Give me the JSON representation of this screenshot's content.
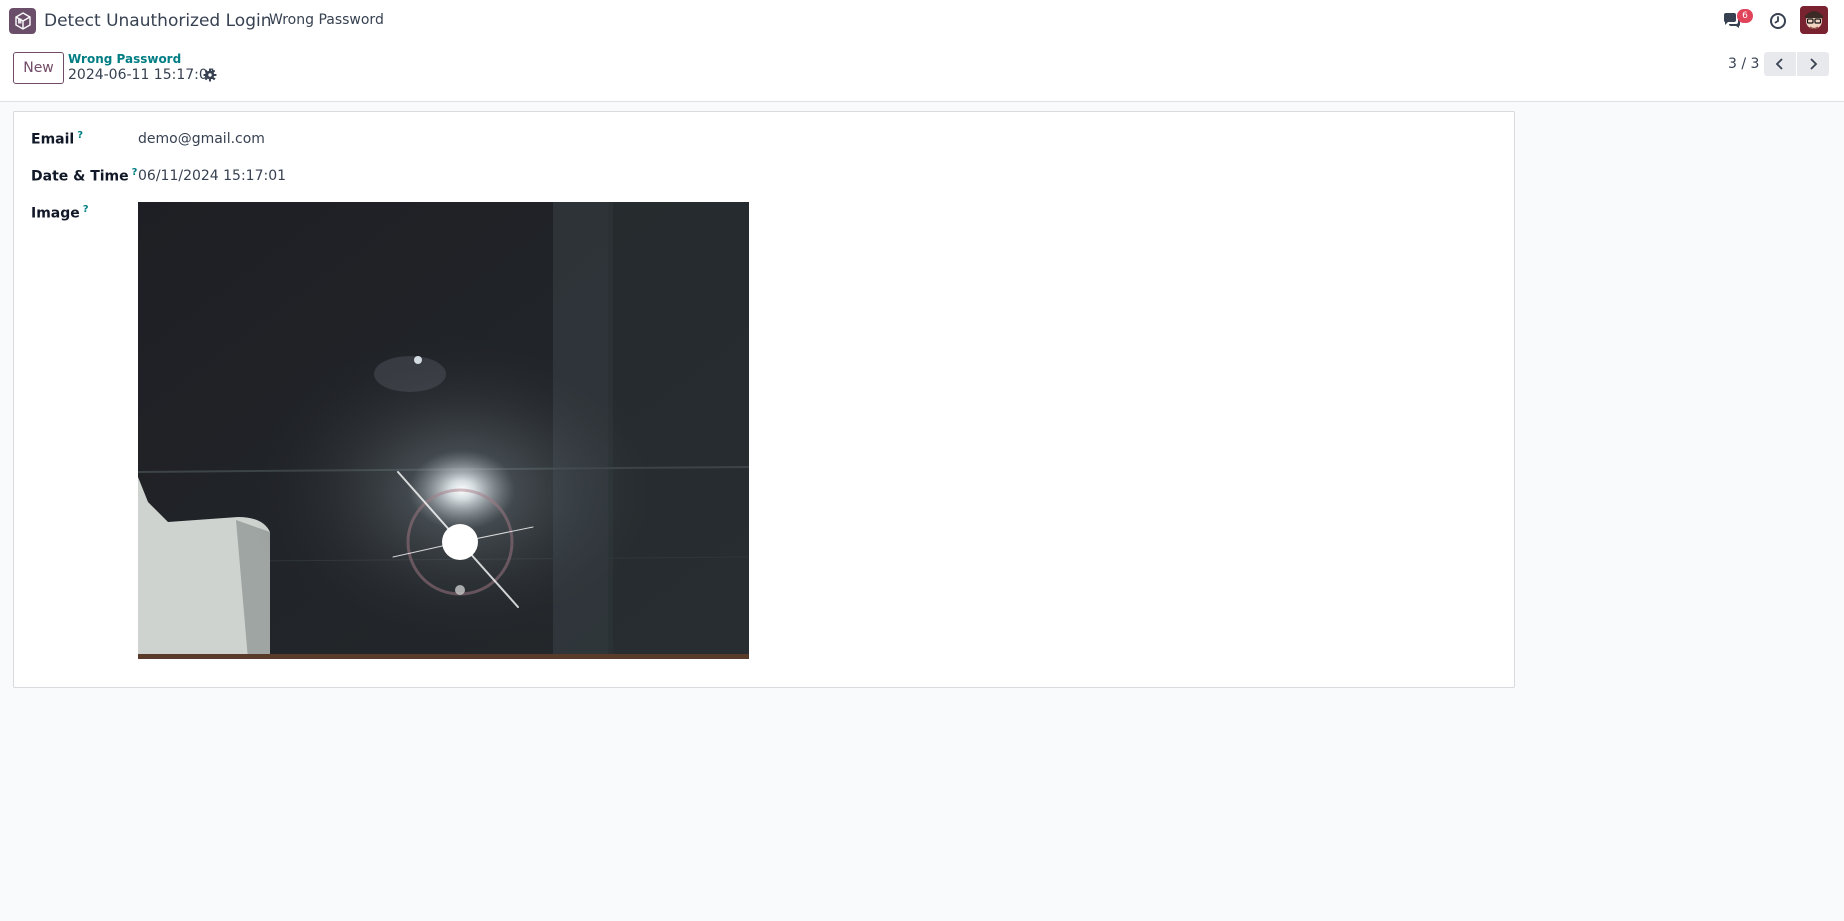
{
  "navbar": {
    "app_name": "Detect Unauthorized Login",
    "menu_item": "Wrong Password",
    "messages_badge": "6",
    "icons": [
      "app-logo-icon",
      "chat-icon",
      "clock-icon",
      "avatar"
    ]
  },
  "control_panel": {
    "new_label": "New",
    "breadcrumb": "Wrong Password",
    "record_title": "2024-06-11 15:17:01",
    "pager": "3 / 3"
  },
  "form": {
    "email_label": "Email",
    "email_value": "demo@gmail.com",
    "datetime_label": "Date & Time",
    "datetime_value": "06/11/2024 15:17:01",
    "image_label": "Image",
    "help_marker": "?"
  },
  "colors": {
    "brand": "#714b67",
    "link": "#017e84",
    "badge": "#e0435a"
  }
}
